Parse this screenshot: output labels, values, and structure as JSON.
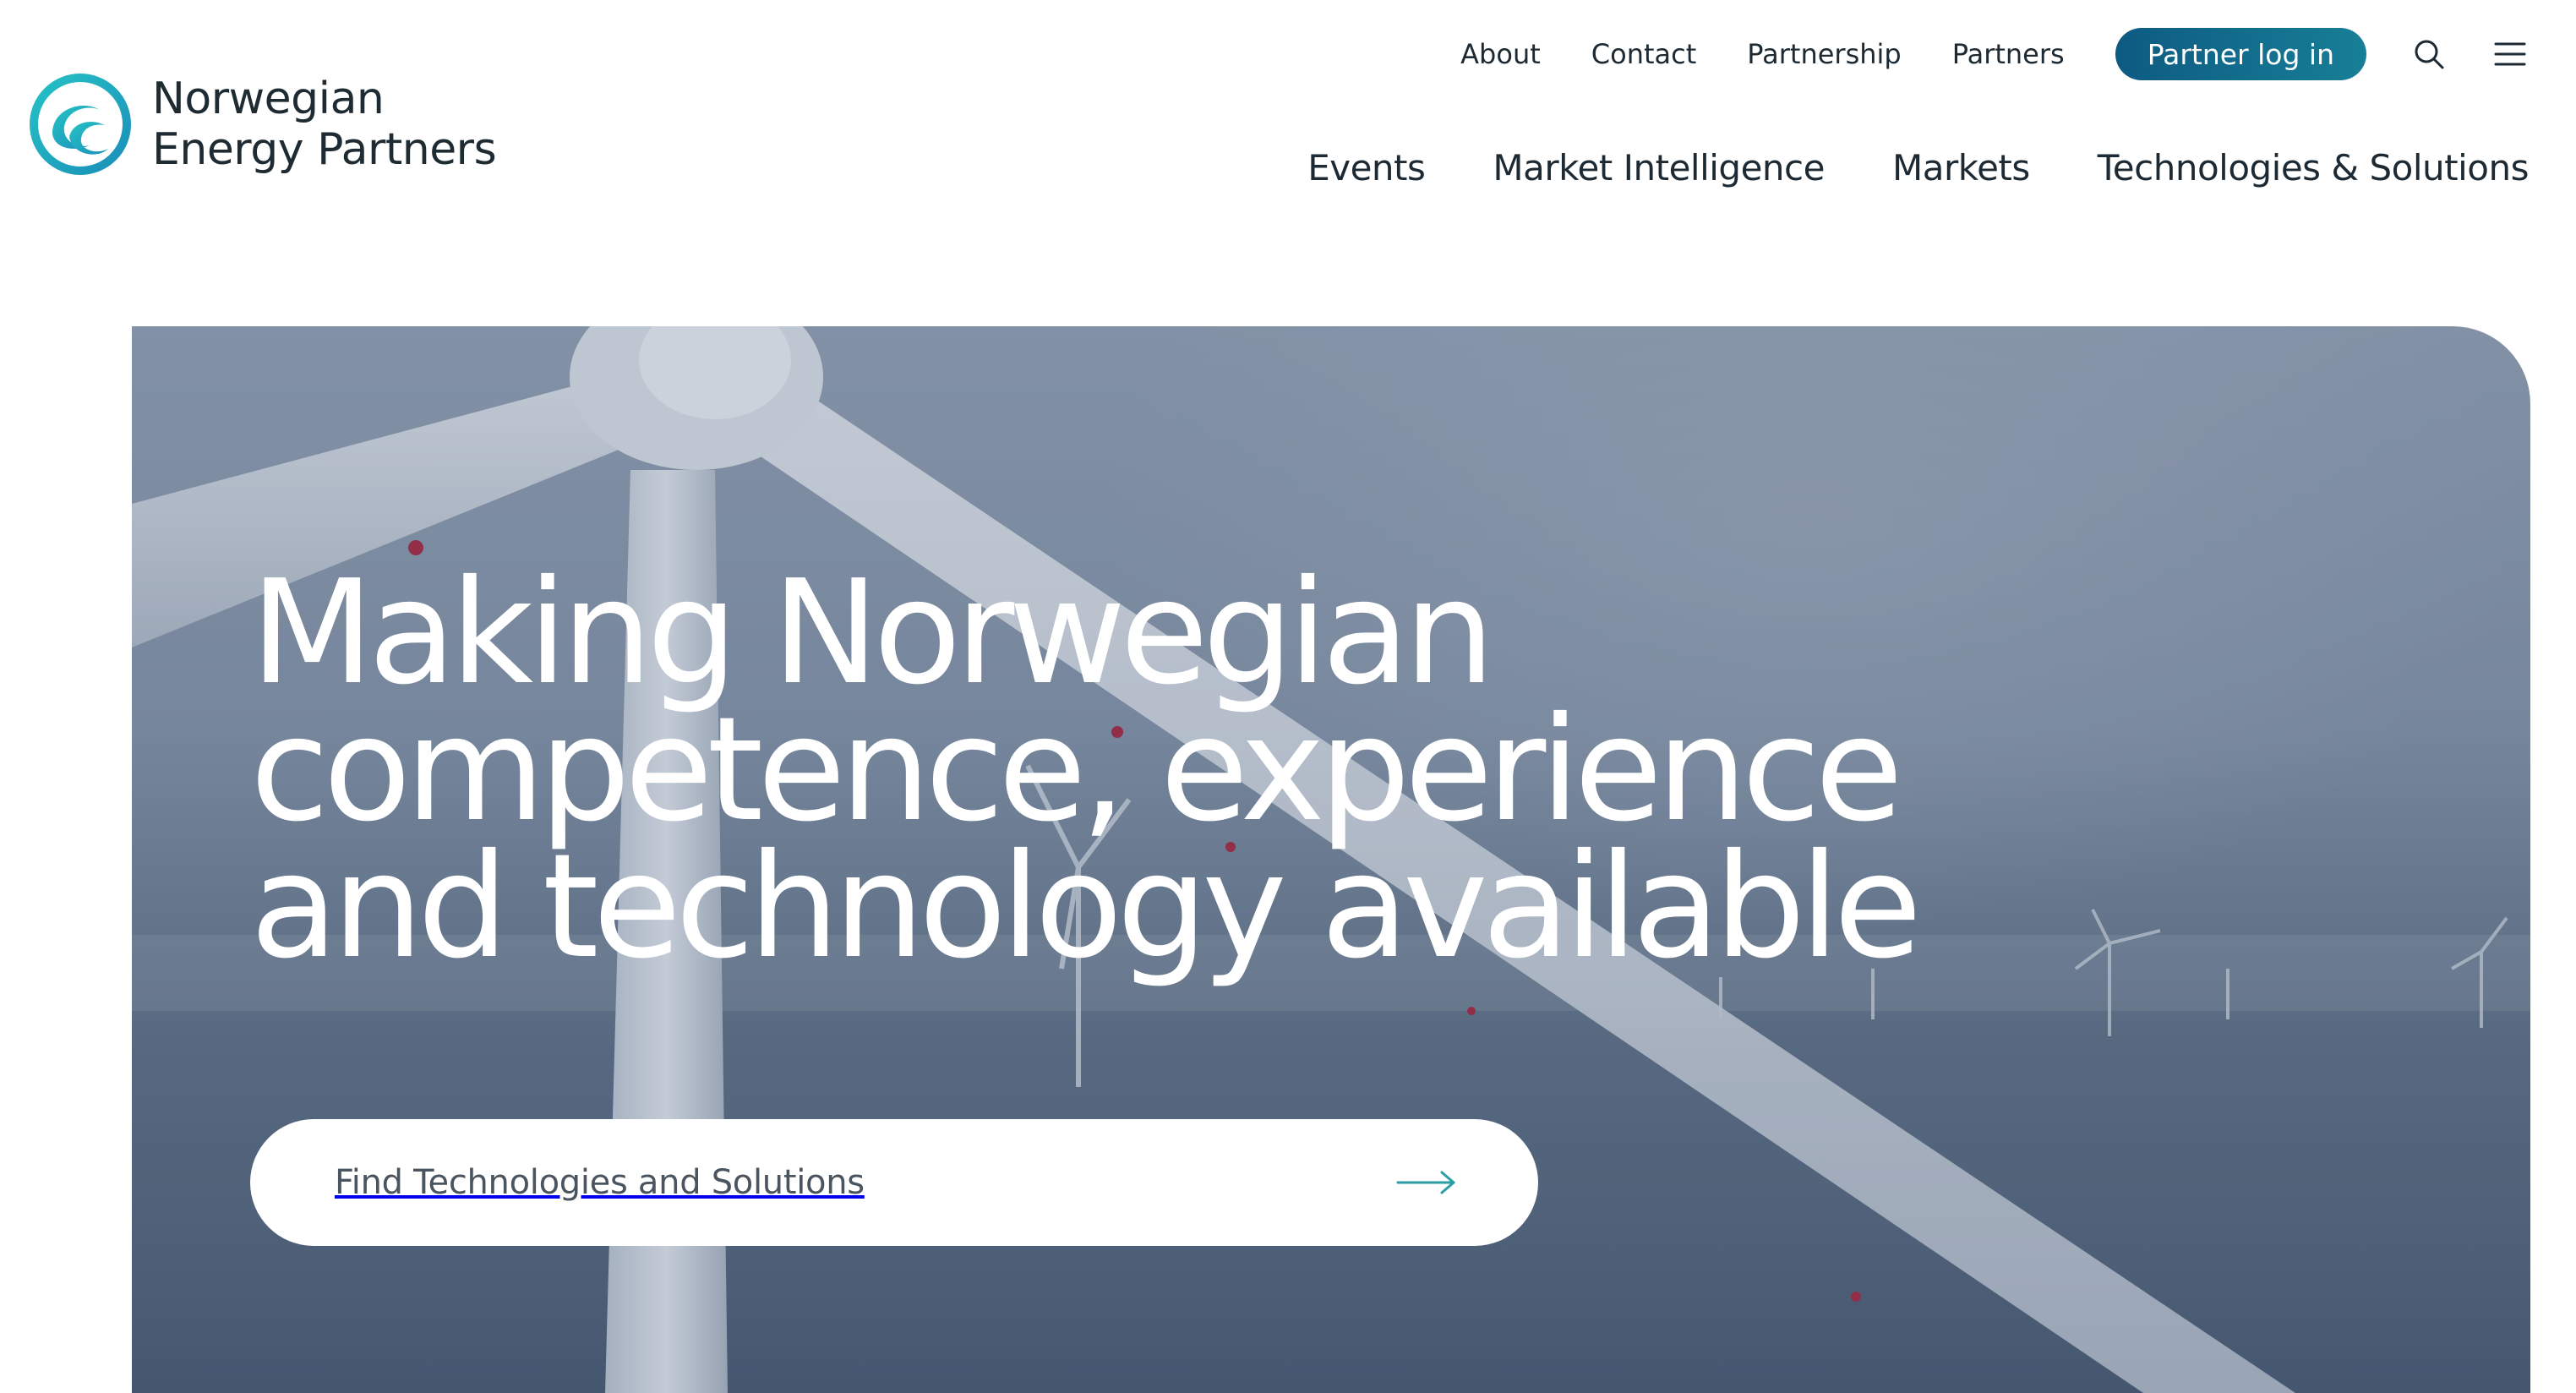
{
  "brand": {
    "line1": "Norwegian",
    "line2": "Energy Partners",
    "logo_icon": "wave-circle-logo",
    "accent_color": "#1bb3c8",
    "brand_color": "#0e5a82"
  },
  "utility_nav": {
    "items": [
      "About",
      "Contact",
      "Partnership",
      "Partners"
    ],
    "login_label": "Partner log in",
    "search_icon": "search-icon",
    "menu_icon": "hamburger-menu-icon"
  },
  "main_nav": {
    "items": [
      "Events",
      "Market Intelligence",
      "Markets",
      "Technologies & Solutions"
    ]
  },
  "hero": {
    "title_lines": [
      "Making Norwegian",
      "competence, experience",
      "and technology available"
    ],
    "cta_label": "Find Technologies and Solutions",
    "cta_icon": "arrow-right-icon"
  }
}
